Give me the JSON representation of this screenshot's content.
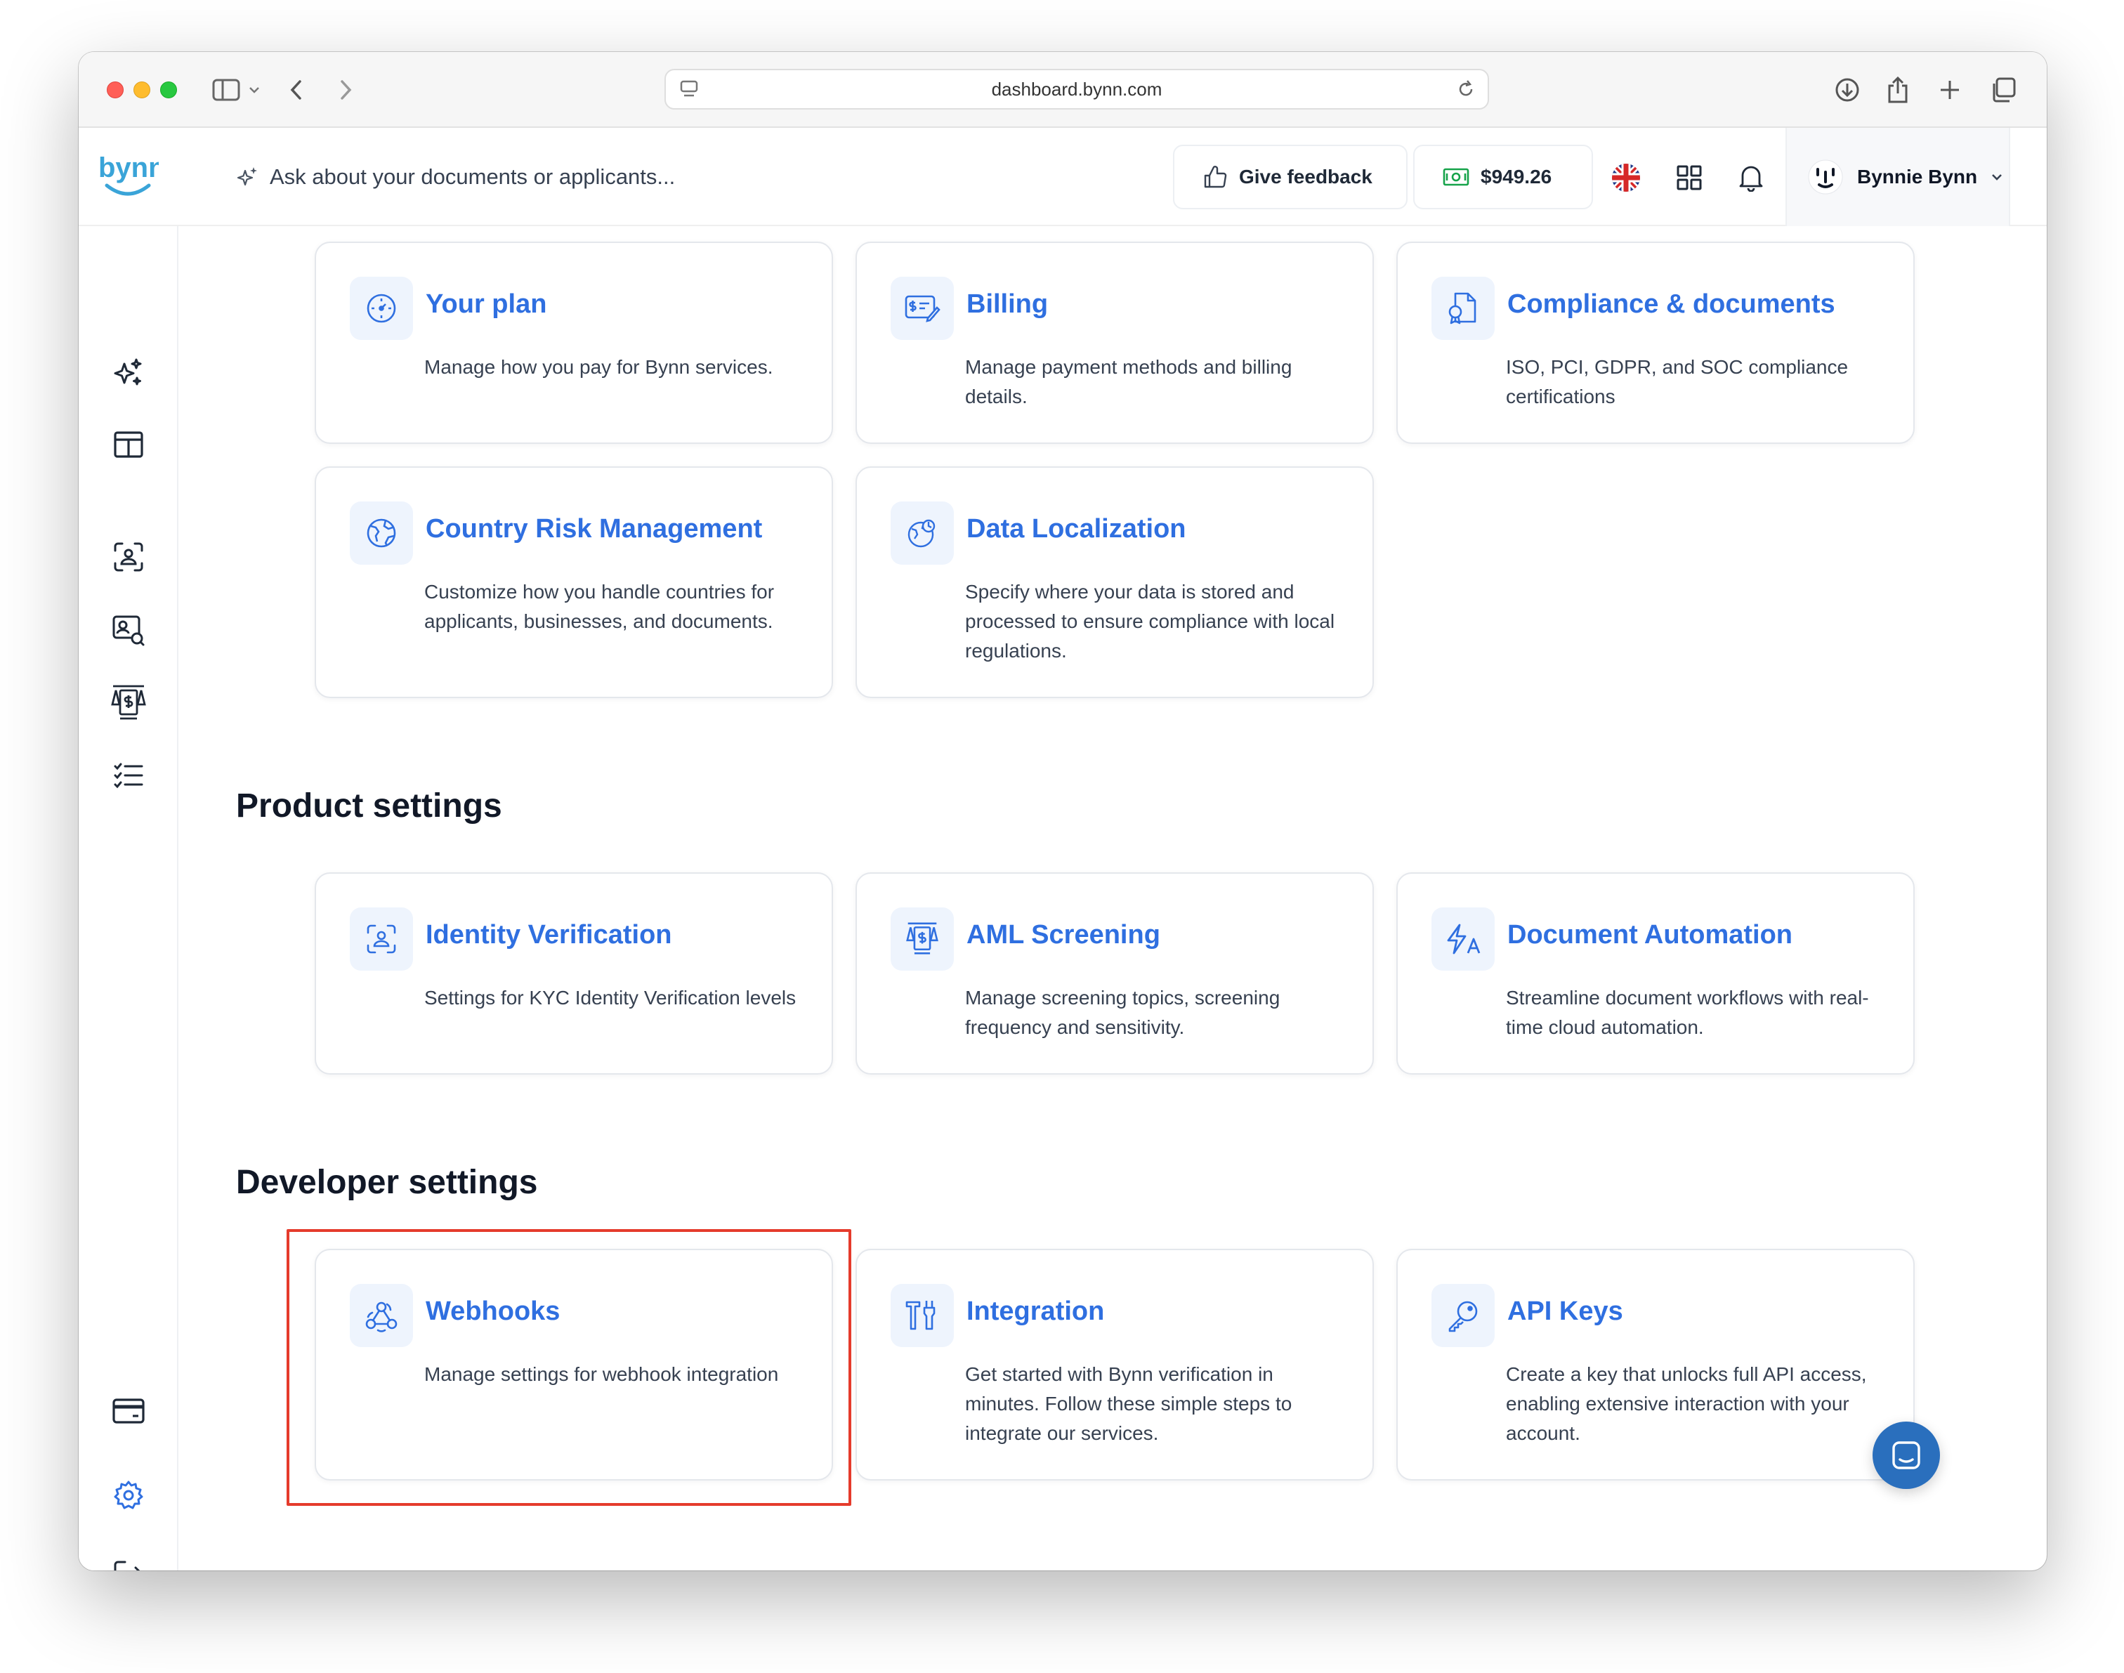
{
  "browser": {
    "url": "dashboard.bynn.com"
  },
  "header": {
    "logo_text": "bynn",
    "ask_placeholder": "Ask about your documents or applicants...",
    "feedback_label": "Give feedback",
    "balance": "$949.26",
    "user_name": "Bynnie Bynn"
  },
  "general_cards": [
    {
      "title": "Your plan",
      "description": "Manage how you pay for Bynn services.",
      "icon": "plan-icon"
    },
    {
      "title": "Billing",
      "description": "Manage payment methods and billing details.",
      "icon": "billing-icon"
    },
    {
      "title": "Compliance & documents",
      "description": "ISO, PCI, GDPR, and SOC compliance certifications",
      "icon": "compliance-icon"
    },
    {
      "title": "Country Risk Management",
      "description": "Customize how you handle countries for applicants, businesses, and documents.",
      "icon": "globe-icon"
    },
    {
      "title": "Data Localization",
      "description": "Specify where your data is stored and processed to ensure compliance with local regulations.",
      "icon": "localization-icon"
    }
  ],
  "product_settings": {
    "title": "Product settings",
    "cards": [
      {
        "title": "Identity Verification",
        "description": "Settings for KYC Identity Verification levels",
        "icon": "face-scan-icon"
      },
      {
        "title": "AML Screening",
        "description": "Manage screening topics, screening frequency and sensitivity.",
        "icon": "aml-icon"
      },
      {
        "title": "Document Automation",
        "description": "Streamline document workflows with real-time cloud automation.",
        "icon": "automation-icon"
      }
    ]
  },
  "developer_settings": {
    "title": "Developer settings",
    "cards": [
      {
        "title": "Webhooks",
        "description": "Manage settings for webhook integration",
        "icon": "webhook-icon"
      },
      {
        "title": "Integration",
        "description": "Get started with Bynn verification in minutes. Follow these simple steps to integrate our services.",
        "icon": "tools-icon"
      },
      {
        "title": "API Keys",
        "description": "Create a key that unlocks full API access, enabling extensive interaction with your account.",
        "icon": "key-icon"
      }
    ]
  },
  "colors": {
    "accent": "#2f6fe0",
    "highlight": "#e53b2c",
    "chat": "#2a6fbd"
  }
}
